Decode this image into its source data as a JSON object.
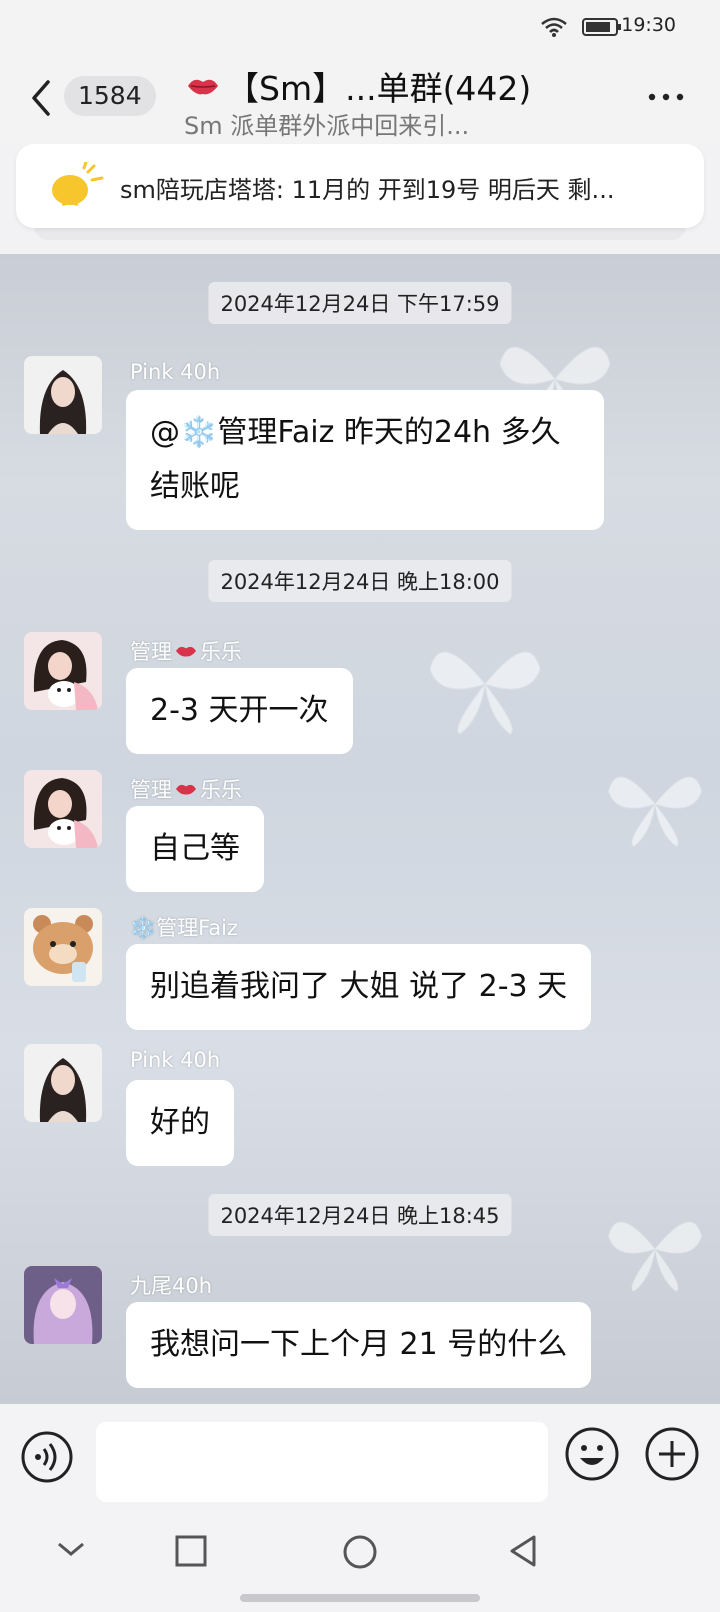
{
  "status_bar": {
    "time": "19:30"
  },
  "header": {
    "unread_count": "1584",
    "title": "【Sm】...单群(442)",
    "subtitle": "Sm 派单群外派中回来引..."
  },
  "notice": {
    "text": "sm陪玩店塔塔: 11月的 开到19号 明后天 剩..."
  },
  "messages": [
    {
      "type": "timestamp",
      "text": "2024年12月24日 下午17:59"
    },
    {
      "type": "message",
      "sender": "Pink 40h",
      "text": "@❄️管理Faiz 昨天的24h 多久结账呢"
    },
    {
      "type": "timestamp",
      "text": "2024年12月24日 晚上18:00"
    },
    {
      "type": "message",
      "sender_prefix": "管理",
      "sender_suffix": "乐乐",
      "text": "2-3 天开一次"
    },
    {
      "type": "message",
      "sender_prefix": "管理",
      "sender_suffix": "乐乐",
      "text": "自己等"
    },
    {
      "type": "message",
      "sender": "❄️管理Faiz",
      "text": "别追着我问了 大姐 说了 2-3 天"
    },
    {
      "type": "message",
      "sender": "Pink 40h",
      "text": "好的"
    },
    {
      "type": "timestamp",
      "text": "2024年12月24日 晚上18:45"
    },
    {
      "type": "message",
      "sender": "九尾40h",
      "text": "我想问一下上个月 21 号的什么"
    }
  ],
  "input": {
    "placeholder": ""
  },
  "colors": {
    "accent_red": "#d8334a",
    "bubble": "#ffffff",
    "bar": "#f3f3f5"
  },
  "icons": [
    "wifi-icon",
    "battery-icon",
    "back-icon",
    "lips-icon",
    "more-icon",
    "lightbulb-icon",
    "voice-icon",
    "emoji-icon",
    "plus-icon",
    "nav-back-chevron-icon",
    "nav-recent-icon",
    "nav-home-icon",
    "nav-back-icon"
  ]
}
